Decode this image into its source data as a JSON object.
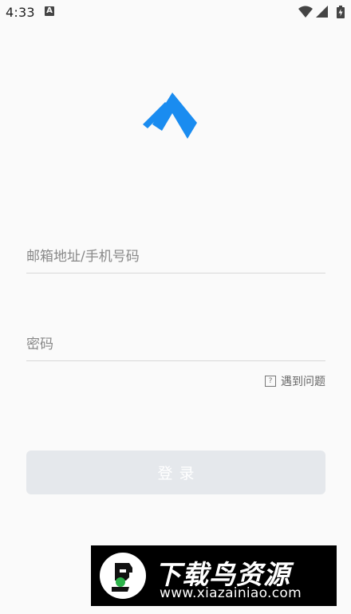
{
  "status_bar": {
    "time": "4:33",
    "notification_icon": "a-letter-icon",
    "icons": [
      "wifi-icon",
      "signal-icon",
      "battery-icon"
    ]
  },
  "logo": {
    "icon": "app-logo-icon",
    "color": "#1a8cf0"
  },
  "form": {
    "email_placeholder": "邮箱地址/手机号码",
    "email_value": "",
    "password_placeholder": "密码",
    "password_value": "",
    "help_label": "遇到问题",
    "help_icon_glyph": "?",
    "login_label": "登录"
  },
  "watermark": {
    "title": "下载鸟资源",
    "url": "www.xiazainiao.com"
  },
  "colors": {
    "background": "#fafafa",
    "accent": "#1a8cf0",
    "button_bg": "#e5e8ec",
    "button_text": "#ffffff",
    "divider": "#d8d8d8"
  }
}
